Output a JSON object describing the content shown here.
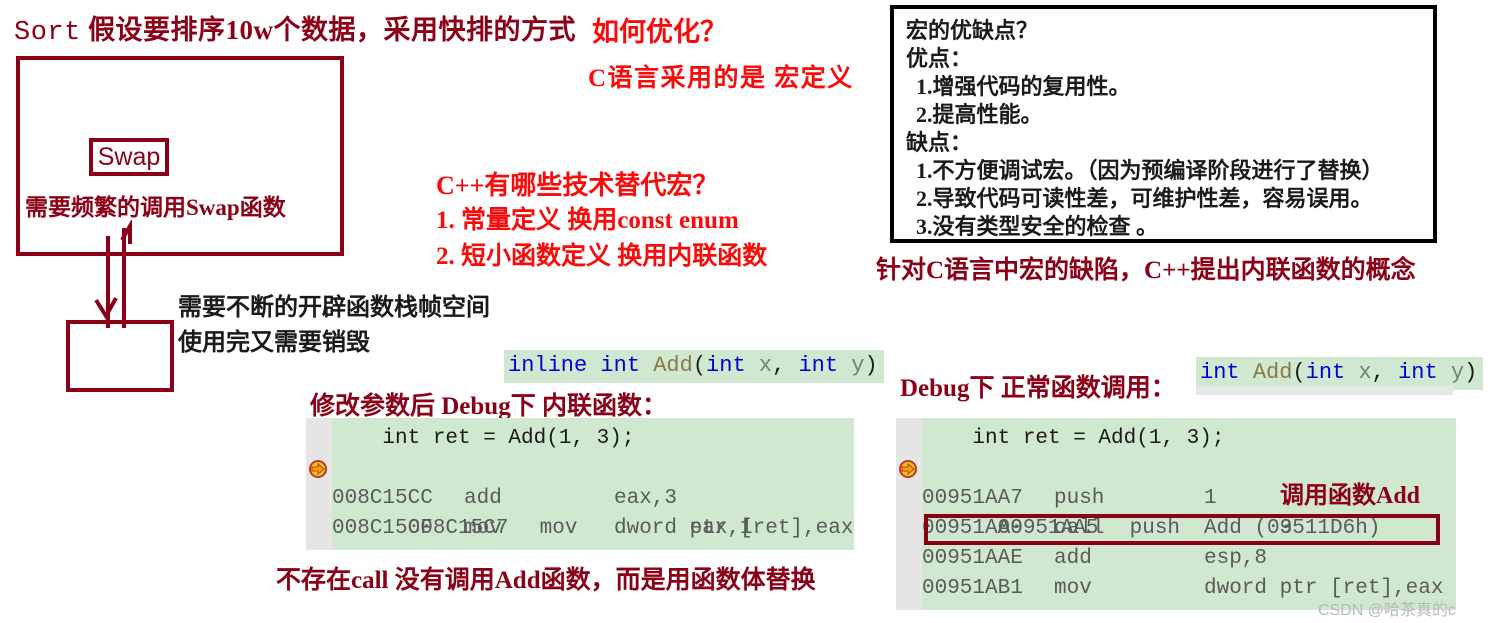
{
  "headline": {
    "sort": "Sort",
    "text": "假设要排序10w个数据，采用快排的方式"
  },
  "left_diagram": {
    "sort_box_label": "",
    "swap_box_label": "Swap",
    "swap_note": "需要频繁的调用Swap函数",
    "stack_box_label": "",
    "stack_note_1": "需要不断的开辟函数栈帧空间",
    "stack_note_2": "使用完又需要销毁"
  },
  "questions": {
    "optimize": "如何优化？",
    "c_macro": "C语言采用的是 宏定义",
    "cpp_alt_title": "C++有哪些技术替代宏？",
    "cpp_alt_1": "1. 常量定义 换用const enum",
    "cpp_alt_2": "2. 短小函数定义 换用内联函数"
  },
  "macro_box": {
    "title": "宏的优缺点？",
    "pros_label": "优点：",
    "pros": [
      "1.增强代码的复用性。",
      "2.提高性能。"
    ],
    "cons_label": "缺点：",
    "cons": [
      "1.不方便调试宏。（因为预编译阶段进行了替换）",
      "2.导致代码可读性差，可维护性差，容易误用。",
      "3.没有类型安全的检查 。"
    ],
    "conclusion": "针对C语言中宏的缺陷，C++提出内联函数的概念"
  },
  "inline_panel": {
    "signature": {
      "kw1": "inline",
      "kw2": "int",
      "fn": "Add",
      "open": "(",
      "kw3": "int",
      "var1": "x",
      "comma": ", ",
      "kw4": "int",
      "var2": "y",
      "close": ")"
    },
    "label": "修改参数后 Debug下 内联函数：",
    "source_line": "    int ret = Add(1, 3);",
    "rows": [
      {
        "addr": "008C15C7",
        "mnem": "mov",
        "operands": "eax,1",
        "marker": "current-instruction-arrow"
      },
      {
        "addr": "008C15CC",
        "mnem": "add",
        "operands": "eax,3",
        "marker": ""
      },
      {
        "addr": "008C15CF",
        "mnem": "mov",
        "operands": "dword ptr [ret],eax",
        "marker": ""
      }
    ],
    "note": "不存在call 没有调用Add函数，而是用函数体替换"
  },
  "normal_panel": {
    "label": "Debug下 正常函数调用：",
    "signature": {
      "kw2": "int",
      "fn": "Add",
      "open": "(",
      "kw3": "int",
      "var1": "x",
      "comma": ", ",
      "kw4": "int",
      "var2": "y",
      "close": ")"
    },
    "source_line": "    int ret = Add(1, 3);",
    "rows": [
      {
        "addr": "00951AA5",
        "mnem": "push",
        "operands": "3",
        "marker": "current-instruction-arrow"
      },
      {
        "addr": "00951AA7",
        "mnem": "push",
        "operands": "1",
        "marker": ""
      },
      {
        "addr": "00951AA9",
        "mnem": "call",
        "operands": "Add (09511D6h)",
        "marker": ""
      },
      {
        "addr": "00951AAE",
        "mnem": "add",
        "operands": "esp,8",
        "marker": ""
      },
      {
        "addr": "00951AB1",
        "mnem": "mov",
        "operands": "dword ptr [ret],eax",
        "marker": ""
      }
    ],
    "call_annotation": "调用函数Add"
  },
  "watermark": "CSDN @哈茶真的c",
  "colors": {
    "dark_red": "#8b0016",
    "bright_red": "#fb0a0a",
    "code_bg": "#cfe8cf",
    "gutter": "#e6e6e6",
    "keyword_blue": "#0000d8"
  }
}
